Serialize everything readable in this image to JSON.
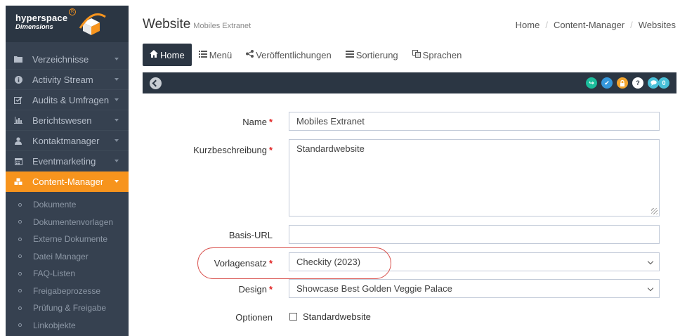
{
  "brand": {
    "name": "hyperspace",
    "sub": "Dimensions",
    "reg": "R"
  },
  "sidebar": {
    "items": [
      {
        "label": "Verzeichnisse",
        "icon": "folder-icon"
      },
      {
        "label": "Activity Stream",
        "icon": "info-icon"
      },
      {
        "label": "Audits & Umfragen",
        "icon": "checkbox-icon"
      },
      {
        "label": "Berichtswesen",
        "icon": "bar-chart-icon"
      },
      {
        "label": "Kontaktmanager",
        "icon": "user-icon"
      },
      {
        "label": "Eventmarketing",
        "icon": "calendar-icon"
      },
      {
        "label": "Content-Manager",
        "icon": "cubes-icon",
        "active": true
      }
    ],
    "sub_items": [
      "Dokumente",
      "Dokumentenvorlagen",
      "Externe Dokumente",
      "Datei Manager",
      "FAQ-Listen",
      "Freigabeprozesse",
      "Prüfung & Freigabe",
      "Linkobjekte"
    ]
  },
  "header": {
    "title": "Website",
    "subtitle": "Mobiles Extranet",
    "breadcrumb": [
      "Home",
      "Content-Manager",
      "Websites"
    ]
  },
  "tabs": [
    {
      "label": "Home",
      "icon": "home-icon",
      "active": true
    },
    {
      "label": "Menü",
      "icon": "list-icon"
    },
    {
      "label": "Veröffentlichungen",
      "icon": "share-icon"
    },
    {
      "label": "Sortierung",
      "icon": "sort-list-icon"
    },
    {
      "label": "Sprachen",
      "icon": "translate-icon"
    }
  ],
  "toolbar_icons": [
    {
      "name": "redo-icon",
      "color": "#1bbc9b",
      "glyph": "↪"
    },
    {
      "name": "check-icon",
      "color": "#3598dc",
      "glyph": "✔"
    },
    {
      "name": "lock-icon",
      "color": "#f3a52f",
      "glyph": "▣"
    },
    {
      "name": "help-icon",
      "color": "#ffffff",
      "glyph": "?"
    },
    {
      "name": "comments-icon",
      "color": "#49c0d8",
      "glyph": "●"
    },
    {
      "name": "comment-count-badge",
      "color": "#49c0d8",
      "glyph": "0"
    }
  ],
  "form": {
    "name_label": "Name",
    "name_value": "Mobiles Extranet",
    "desc_label": "Kurzbeschreibung",
    "desc_value": "Standardwebsite",
    "url_label": "Basis-URL",
    "url_value": "",
    "template_label": "Vorlagensatz",
    "template_value": "Checkity (2023)",
    "design_label": "Design",
    "design_value": "Showcase Best Golden Veggie Palace",
    "options_label": "Optionen",
    "option_default": "Standardwebsite",
    "required_mark": "*"
  }
}
